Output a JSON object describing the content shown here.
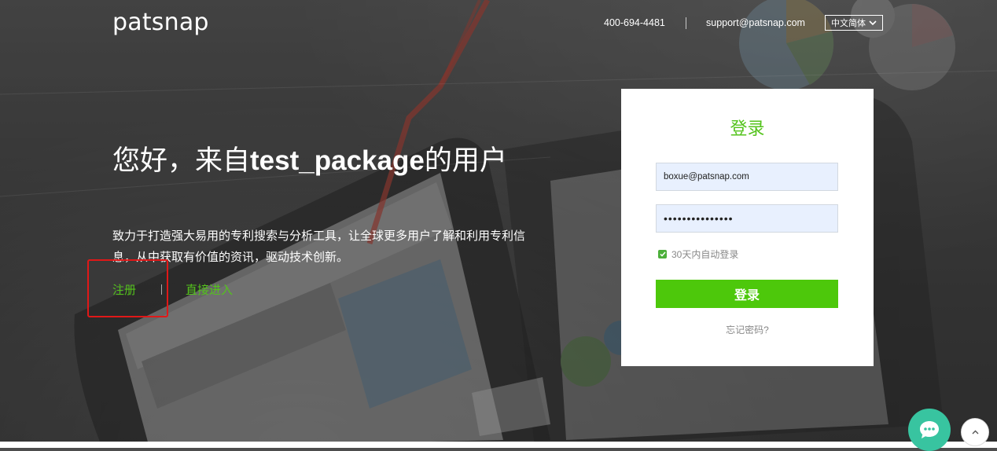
{
  "header": {
    "logo": "patsnap",
    "phone": "400-694-4481",
    "email": "support@patsnap.com",
    "language": "中文简体"
  },
  "hero": {
    "title_prefix": "您好，来自",
    "title_bold": "test_package",
    "title_suffix": "的用户",
    "description": "致力于打造强大易用的专利搜索与分析工具，让全球更多用户了解和利用专利信息，从中获取有价值的资讯，驱动技术创新。",
    "register_link": "注册",
    "enter_link": "直接进入"
  },
  "login": {
    "title": "登录",
    "email_value": "boxue@patsnap.com",
    "password_masked": "•••••••••••••••",
    "remember_label": "30天内自动登录",
    "remember_checked": true,
    "submit_label": "登录",
    "forgot_label": "忘记密码?"
  },
  "floating": {
    "chat_icon": "chat-bubble-icon",
    "back_to_top_icon": "chevron-up-icon"
  },
  "colors": {
    "accent_green": "#4dc80b",
    "link_green": "#54c31c",
    "highlight_red": "#e01818",
    "chat_teal": "#38c4a0"
  }
}
